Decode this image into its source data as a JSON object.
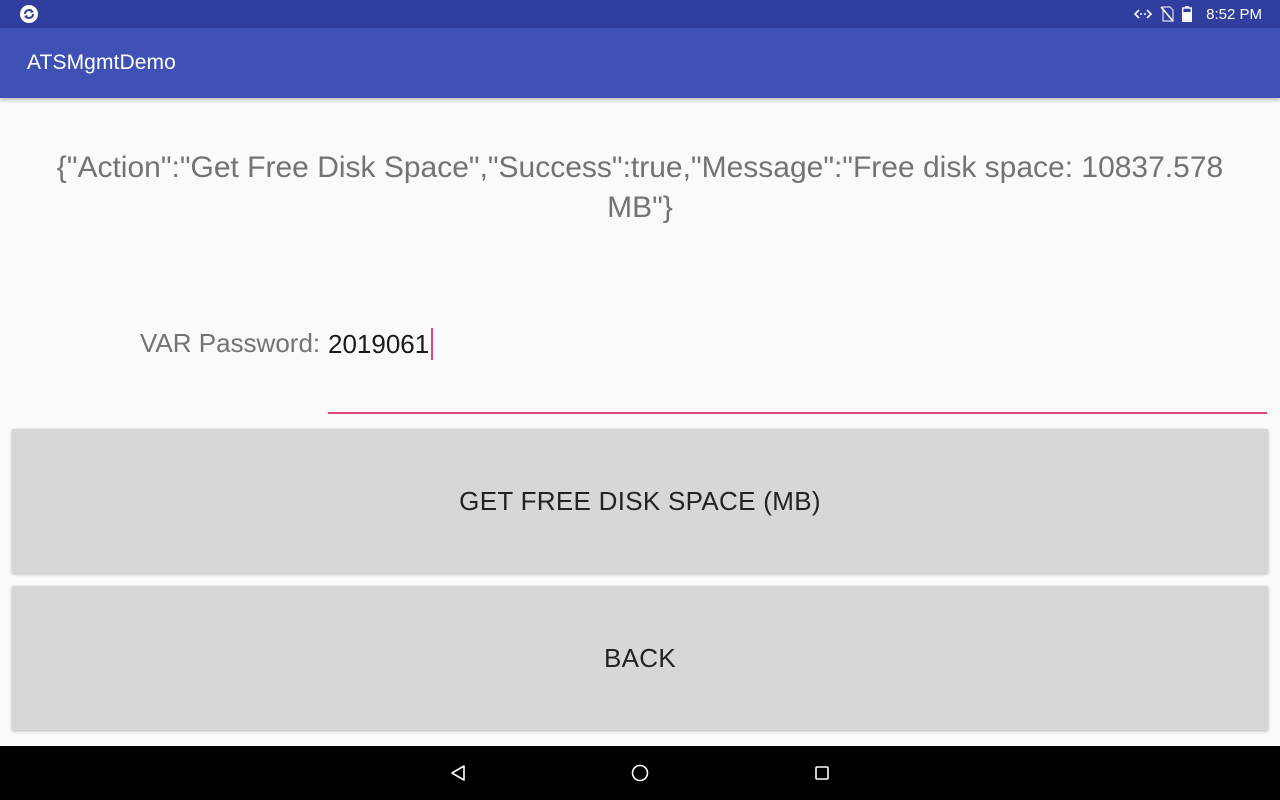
{
  "status_bar": {
    "time": "8:52 PM",
    "icons": [
      "app-sync-icon",
      "code-icon",
      "no-sim-icon",
      "battery-icon"
    ]
  },
  "app_bar": {
    "title": "ATSMgmtDemo"
  },
  "main": {
    "result_text": "{\"Action\":\"Get Free Disk Space\",\"Success\":true,\"Message\":\"Free disk space: 10837.578 MB\"}",
    "password_label": "VAR Password:",
    "password_value": "2019061",
    "get_space_label": "GET FREE DISK SPACE (MB)",
    "back_label": "BACK"
  },
  "nav_bar": {
    "icons": [
      "back-triangle-icon",
      "home-circle-icon",
      "recents-square-icon"
    ]
  },
  "colors": {
    "status_bar": "#303f9f",
    "app_bar": "#3f51b5",
    "accent": "#e0457b",
    "button_bg": "#d6d7d7",
    "text_secondary": "#737373"
  }
}
